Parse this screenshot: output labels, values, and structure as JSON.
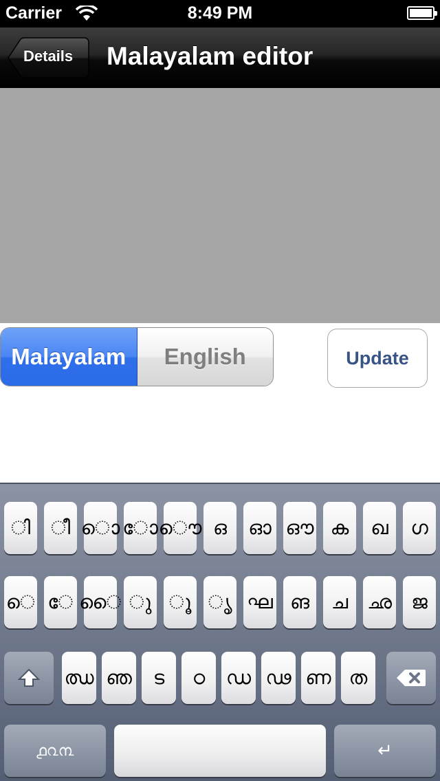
{
  "status_bar": {
    "carrier": "Carrier",
    "time": "8:49 PM",
    "wifi_icon": "wifi-icon",
    "battery_icon": "battery-icon"
  },
  "nav": {
    "back_label": "Details",
    "title": "Malayalam editor"
  },
  "segmented": {
    "options": [
      "Malayalam",
      "English"
    ],
    "selected": "Malayalam"
  },
  "update_label": "Update",
  "keyboard": {
    "row1": [
      "ി",
      "ീ",
      "ൊ",
      "ോ",
      "ൌ",
      "ഒ",
      "ഓ",
      "ഔ",
      "ക",
      "ഖ",
      "ഗ"
    ],
    "row2": [
      "െ",
      "േ",
      "ൈ",
      "ു",
      "ൂ",
      "ൃ",
      "ഘ",
      "ങ",
      "ച",
      "ഛ",
      "ജ"
    ],
    "row3": [
      "ഝ",
      "ഞ",
      "ട",
      "ഠ",
      "ഡ",
      "ഢ",
      "ണ",
      "ത"
    ],
    "mode_label": "൧൨൩",
    "return_label": "↵",
    "shift_icon": "shift-icon",
    "delete_icon": "delete-icon"
  },
  "colors": {
    "segment_selected": "#2f6fea",
    "update_text": "#385487",
    "content_area": "#a6a6a6"
  }
}
